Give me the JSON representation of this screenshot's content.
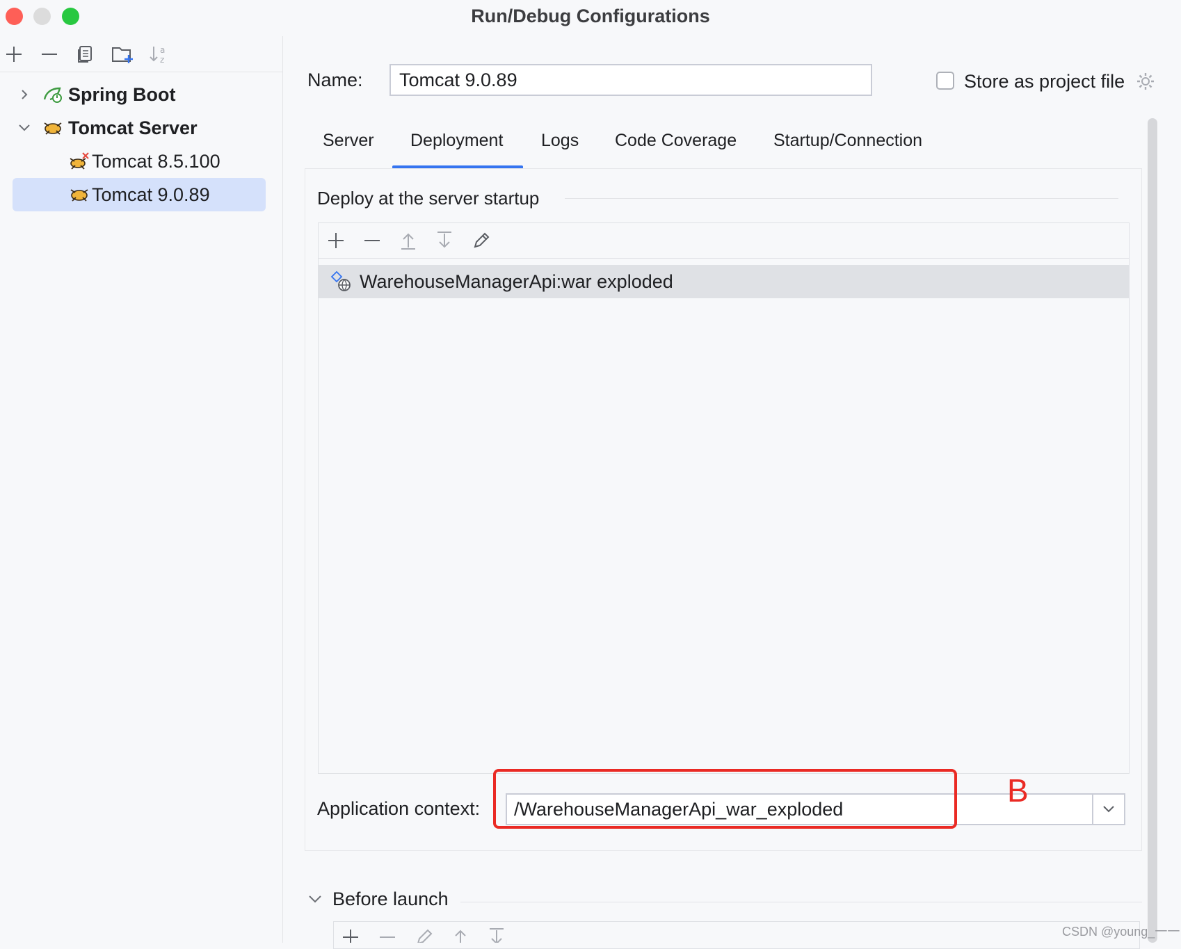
{
  "window": {
    "title": "Run/Debug Configurations"
  },
  "left_toolbar": {
    "icons": [
      "add-icon",
      "remove-icon",
      "copy-icon",
      "new-folder-icon",
      "sort-az-icon"
    ]
  },
  "tree": {
    "items": [
      {
        "label": "Spring Boot",
        "expanded": false,
        "bold": true,
        "icon": "spring-boot-icon"
      },
      {
        "label": "Tomcat Server",
        "expanded": true,
        "bold": true,
        "icon": "tomcat-icon"
      },
      {
        "label": "Tomcat 8.5.100",
        "icon": "tomcat-error-icon"
      },
      {
        "label": "Tomcat 9.0.89",
        "icon": "tomcat-icon",
        "selected": true
      }
    ]
  },
  "form": {
    "name_label": "Name:",
    "name_value": "Tomcat 9.0.89",
    "store_label": "Store as project file",
    "store_checked": false
  },
  "tabs": [
    {
      "label": "Server"
    },
    {
      "label": "Deployment",
      "active": true
    },
    {
      "label": "Logs"
    },
    {
      "label": "Code Coverage"
    },
    {
      "label": "Startup/Connection"
    }
  ],
  "deployment": {
    "section_title": "Deploy at the server startup",
    "artifacts": [
      {
        "label": "WarehouseManagerApi:war exploded",
        "icon": "artifact-icon"
      }
    ],
    "context_label": "Application context:",
    "context_value": "/WarehouseManagerApi_war_exploded",
    "annotation": "B"
  },
  "before_launch": {
    "title": "Before launch"
  },
  "watermark": "CSDN @young_一一",
  "colors": {
    "accent": "#3574f0",
    "selection": "#d5e1fb",
    "annotation": "#ea2a24",
    "close": "#fe5f57",
    "minimize": "#dcdcdc",
    "zoom": "#28c840"
  }
}
